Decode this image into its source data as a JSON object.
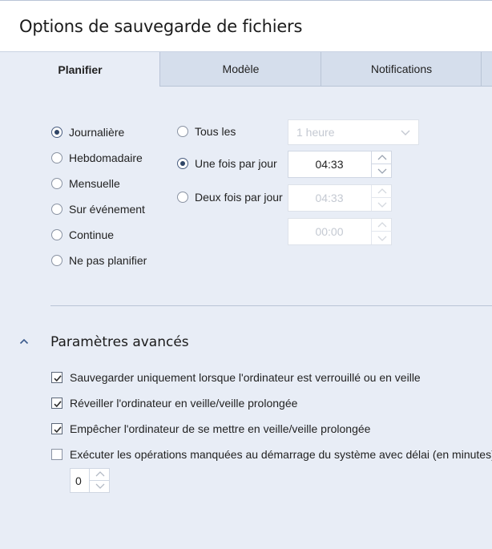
{
  "title": "Options de sauvegarde de fichiers",
  "tabs": [
    {
      "label": "Planifier",
      "active": true
    },
    {
      "label": "Modèle",
      "active": false
    },
    {
      "label": "Notifications",
      "active": false
    }
  ],
  "frequency": [
    {
      "label": "Journalière",
      "checked": true
    },
    {
      "label": "Hebdomadaire",
      "checked": false
    },
    {
      "label": "Mensuelle",
      "checked": false
    },
    {
      "label": "Sur événement",
      "checked": false
    },
    {
      "label": "Continue",
      "checked": false
    },
    {
      "label": "Ne pas planifier",
      "checked": false
    }
  ],
  "daily": {
    "every_label": "Tous les",
    "every_value": "1 heure",
    "once_label": "Une fois par jour",
    "once_time": "04:33",
    "twice_label": "Deux fois par jour",
    "twice_time_1": "04:33",
    "twice_time_2": "00:00"
  },
  "advanced": {
    "title": "Paramètres avancés",
    "options": [
      {
        "label": "Sauvegarder uniquement lorsque l'ordinateur est verrouillé ou en veille",
        "checked": true
      },
      {
        "label": "Réveiller l'ordinateur en veille/veille prolongée",
        "checked": true
      },
      {
        "label": "Empêcher l'ordinateur de se mettre en veille/veille prolongée",
        "checked": true
      },
      {
        "label": "Exécuter les opérations manquées au démarrage du système avec délai (en minutes)",
        "checked": false
      }
    ],
    "delay_value": "0"
  },
  "icons": {
    "chevron": "chevron-down-icon",
    "collapse": "chevron-up-icon",
    "check": "check-icon"
  },
  "colors": {
    "background": "#e8edf6",
    "tab_inactive": "#d5deec",
    "accent": "#2f4566"
  }
}
